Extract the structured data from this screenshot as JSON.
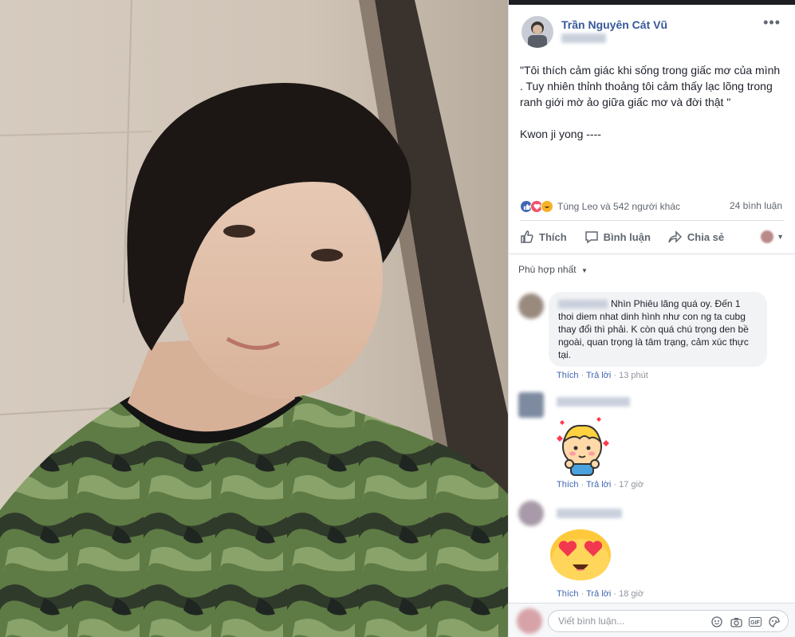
{
  "post": {
    "author": "Trần Nguyên Cát Vũ",
    "caption": "\"Tôi thích cảm giác khi sống trong giấc mơ của mình\n. Tuy nhiên thỉnh thoảng tôi cảm thấy lạc lõng trong\nranh giới mờ ảo giữa giấc mơ và đời thật \"\n\nKwon ji yong ----",
    "reactions_text": "Tùng Leo và 542 người khác",
    "comments_count": "24 bình luận"
  },
  "actions": {
    "like": "Thích",
    "comment": "Bình luận",
    "share": "Chia sẻ"
  },
  "sort_label": "Phù hợp nhất",
  "comments": [
    {
      "text": "Nhìn Phiêu lãng quá oy. Đến 1 thoi diem nhat dinh hình như con ng ta cubg thay đổi thì phải. K còn quá chú trọng den bề ngoài, quan trọng là tâm trạng, cảm xúc thực tại.",
      "like": "Thích",
      "reply": "Trả lời",
      "time": "13 phút"
    },
    {
      "like": "Thích",
      "reply": "Trả lời",
      "time": "17 giờ"
    },
    {
      "like": "Thích",
      "reply": "Trả lời",
      "time": "18 giờ"
    }
  ],
  "composer": {
    "placeholder": "Viết bình luận..."
  },
  "colors": {
    "link": "#365899",
    "meta_link": "#4267b2",
    "text": "#1d2129",
    "muted": "#606770"
  }
}
